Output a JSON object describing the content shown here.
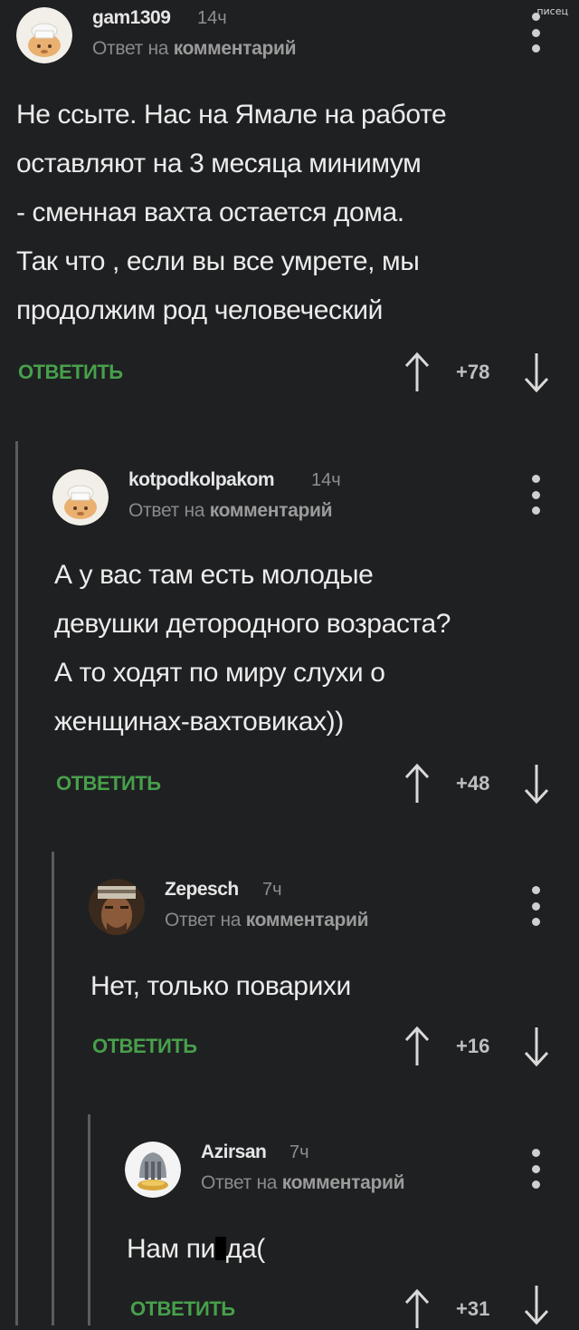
{
  "watermark": "писец",
  "reply_label": "ОТВЕТИТЬ",
  "reply_prefix": "Ответ на",
  "reply_target": "комментарий",
  "comments": [
    {
      "username": "gam1309",
      "time": "14ч",
      "avatar": "cook-avatar",
      "text_lines": [
        "Не ссыте. Нас на Ямале на работе",
        "оставляют на 3 месяца минимум",
        "- сменная вахта остается дома.",
        "Так что , если вы все умрете, мы",
        "продолжим род человеческий"
      ],
      "score": "+78"
    },
    {
      "username": "kotpodkolpakom",
      "time": "14ч",
      "avatar": "cook-avatar",
      "text_lines": [
        "А у вас там есть молодые",
        "девушки детородного возраста?",
        "А то ходят по миру слухи о",
        "женщинах-вахтовиках))"
      ],
      "score": "+48"
    },
    {
      "username": "Zepesch",
      "time": "7ч",
      "avatar": "warrior-avatar",
      "text_lines": [
        "Нет, только поварихи"
      ],
      "score": "+16"
    },
    {
      "username": "Azirsan",
      "time": "7ч",
      "avatar": "helmet-avatar",
      "text_before_censor": "Нам пи",
      "text_after_censor": "да(",
      "score": "+31"
    }
  ],
  "colors": {
    "background": "#1f2022",
    "reply_button": "#47a04b",
    "thread_line": "#5a5c60"
  }
}
